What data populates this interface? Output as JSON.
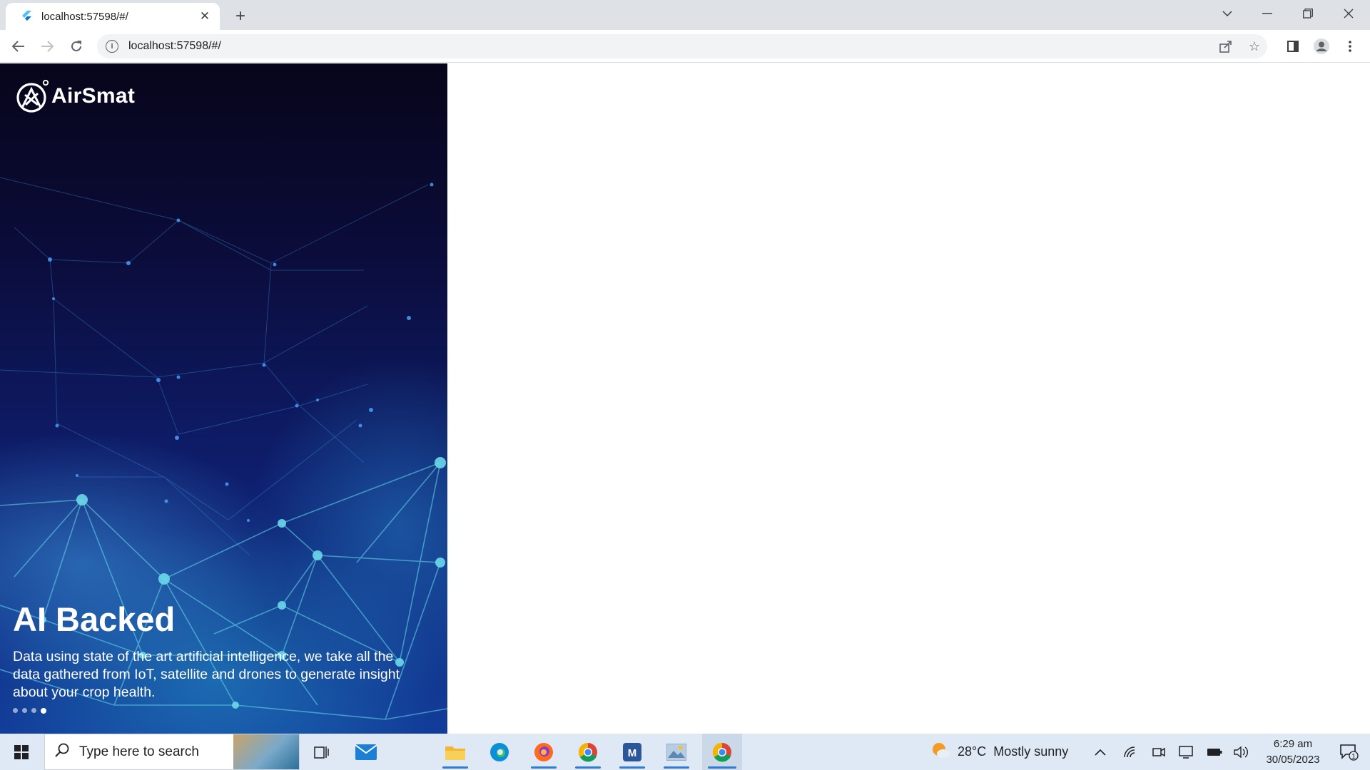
{
  "browser": {
    "tab_title": "localhost:57598/#/",
    "url": "localhost:57598/#/",
    "icons": {
      "favicon": "flutter-icon",
      "tab_close": "close-icon",
      "new_tab": "plus-icon",
      "back": "arrow-left-icon",
      "forward": "arrow-right-icon",
      "reload": "reload-icon",
      "site_info": "info-icon",
      "share": "share-icon",
      "bookmark": "star-icon",
      "side_panel": "side-panel-icon",
      "profile": "profile-icon",
      "menu": "kebab-menu-icon",
      "tab_search": "chevron-down-icon",
      "minimize": "minimize-icon",
      "restore": "restore-icon",
      "close_window": "close-icon"
    }
  },
  "hero": {
    "brand": "AirSmat",
    "title": "AI Backed",
    "body": "Data using state of the art artificial intelligence, we take all the data gathered from IoT, satellite and drones to generate insight about your crop health.",
    "carousel": {
      "count": 4,
      "active_index": 3
    }
  },
  "taskbar": {
    "search_placeholder": "Type here to search",
    "weather": {
      "temp": "28°C",
      "condition": "Mostly sunny"
    },
    "time": "6:29 am",
    "date": "30/05/2023",
    "notification_count": "1",
    "apps": [
      "start-icon",
      "search-icon",
      "task-view-icon",
      "mail-icon",
      "file-explorer-icon",
      "edge-icon",
      "firefox-icon",
      "chrome-icon",
      "word-icon",
      "photos-icon",
      "chrome-icon"
    ]
  },
  "colors": {
    "accent": "#2f7bd6",
    "hero_dark": "#07051a",
    "hero_blue": "#123d9a"
  }
}
